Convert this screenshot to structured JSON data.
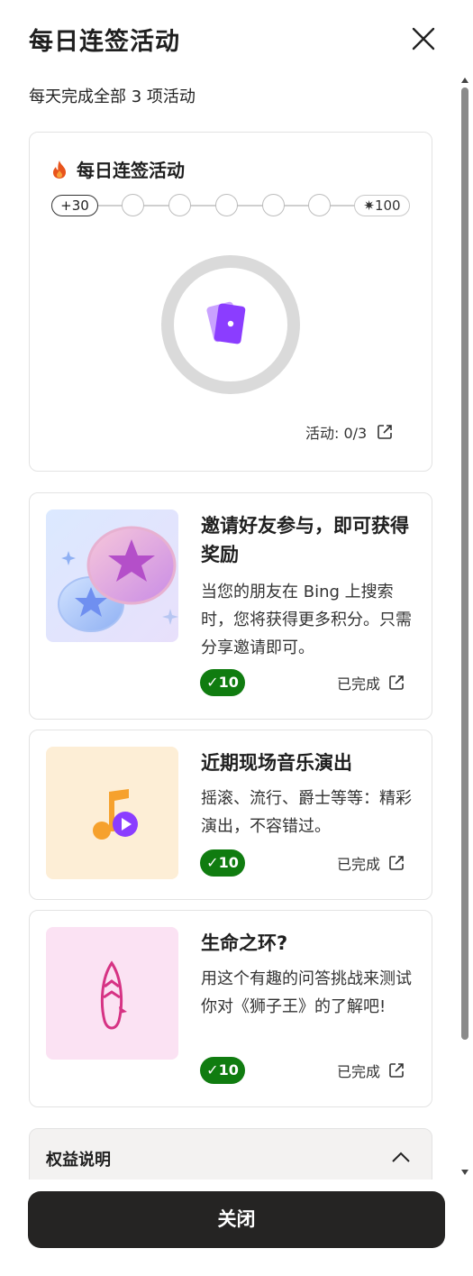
{
  "header": {
    "title": "每日连签活动",
    "subtitle": "每天完成全部 3 项活动"
  },
  "streak": {
    "title": "每日连签活动",
    "start_label": "+30",
    "end_label": "✷100",
    "activity_count": "活动: 0/3",
    "progress": 0
  },
  "tasks": [
    {
      "title": "邀请好友参与，即可获得奖励",
      "description": "当您的朋友在 Bing 上搜索时，您将获得更多积分。只需分享邀请即可。",
      "points": "✓10",
      "status": "已完成"
    },
    {
      "title": "近期现场音乐演出",
      "description": "摇滚、流行、爵士等等：精彩演出，不容错过。",
      "points": "✓10",
      "status": "已完成"
    },
    {
      "title": "生命之环?",
      "description": "用这个有趣的问答挑战来测试你对《狮子王》的了解吧!",
      "points": "✓10",
      "status": "已完成"
    }
  ],
  "benefits": {
    "label": "权益说明"
  },
  "footer": {
    "close_label": "关闭"
  },
  "colors": {
    "badge": "#107c10",
    "button": "#252423",
    "accent_purple": "#8b3dff"
  }
}
